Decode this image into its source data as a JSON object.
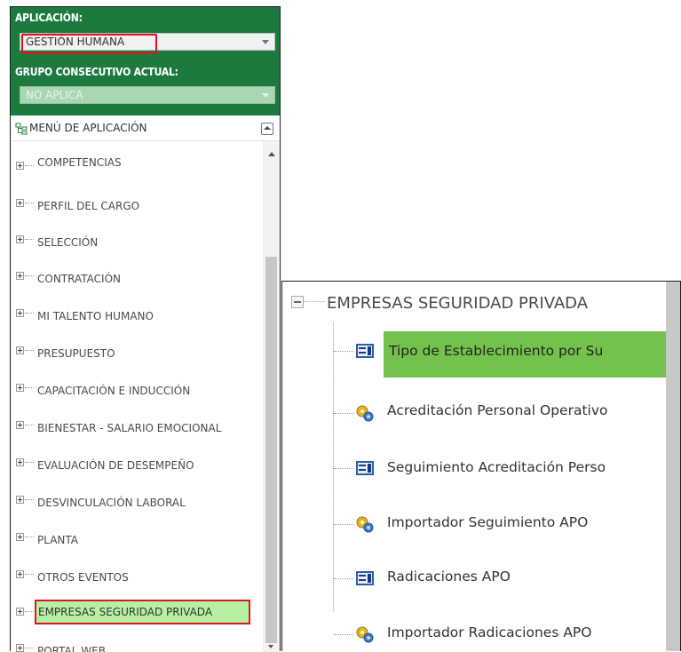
{
  "header": {
    "app_label": "APLICACIÓN:",
    "app_value": "GESTIÓN HUMANA",
    "grupo_label": "GRUPO CONSECUTIVO ACTUAL:",
    "grupo_value": "NO APLICA",
    "brand_color": "#1c7a3e"
  },
  "menu": {
    "title": "MENÚ DE APLICACIÓN",
    "items": [
      {
        "label": "COMPETENCIAS"
      },
      {
        "label": "PERFIL DEL CARGO"
      },
      {
        "label": "SELECCIÓN"
      },
      {
        "label": "CONTRATACIÓN"
      },
      {
        "label": "MI TALENTO HUMANO"
      },
      {
        "label": "PRESUPUESTO"
      },
      {
        "label": "CAPACITACIÓN E INDUCCIÓN"
      },
      {
        "label": "BIENESTAR - SALARIO EMOCIONAL"
      },
      {
        "label": "EVALUACIÓN DE DESEMPEÑO"
      },
      {
        "label": "DESVINCULACIÓN LABORAL"
      },
      {
        "label": "PLANTA"
      },
      {
        "label": "OTROS EVENTOS"
      },
      {
        "label": "EMPRESAS SEGURIDAD PRIVADA",
        "selected": true
      },
      {
        "label": "PORTAL WEB"
      }
    ]
  },
  "submenu": {
    "group_label": "EMPRESAS SEGURIDAD PRIVADA",
    "items": [
      {
        "label": "Tipo de Establecimiento por Su",
        "icon": "form-icon",
        "selected": true
      },
      {
        "label": "Acreditación Personal Operativo",
        "icon": "process-gear-icon"
      },
      {
        "label": "Seguimiento Acreditación Perso",
        "icon": "form-icon"
      },
      {
        "label": "Importador Seguimiento APO",
        "icon": "process-gear-icon"
      },
      {
        "label": "Radicaciones APO",
        "icon": "form-icon"
      },
      {
        "label": "Importador Radicaciones APO",
        "icon": "process-gear-icon"
      }
    ]
  },
  "colors": {
    "highlight_border": "#e0141e",
    "selected_item_bg": "#b6f0a2",
    "selected_subitem_bg": "#74c24d"
  }
}
